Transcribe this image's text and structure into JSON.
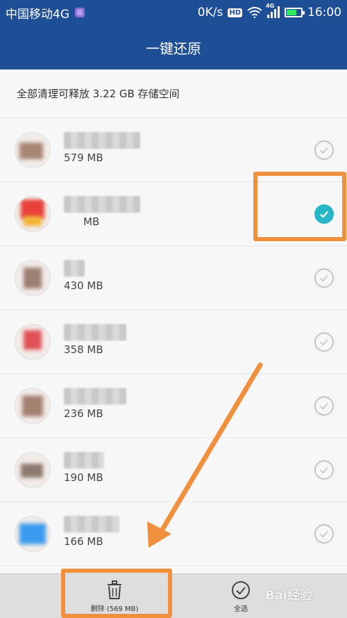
{
  "status_bar": {
    "carrier": "中国移动4G",
    "speed": "0K/s",
    "hd": "HD",
    "network": "4G",
    "time": "16:00",
    "battery_level": 0.7
  },
  "header": {
    "title": "一键还原"
  },
  "summary": {
    "text": "全部清理可释放 3.22 GB 存储空间"
  },
  "apps": [
    {
      "size": "579 MB",
      "checked": false
    },
    {
      "size": "MB",
      "checked": true
    },
    {
      "size": "430 MB",
      "checked": false
    },
    {
      "size": "358 MB",
      "checked": false
    },
    {
      "size": "236 MB",
      "checked": false
    },
    {
      "size": "190 MB",
      "checked": false
    },
    {
      "size": "166 MB",
      "checked": false
    }
  ],
  "bottom_bar": {
    "delete_label": "删除 (569 MB)",
    "select_all_label": "全选"
  },
  "watermark": "Bai经验",
  "colors": {
    "header_bg": "#1e4f96",
    "check_on": "#27b6c6",
    "highlight": "#f0903d"
  }
}
